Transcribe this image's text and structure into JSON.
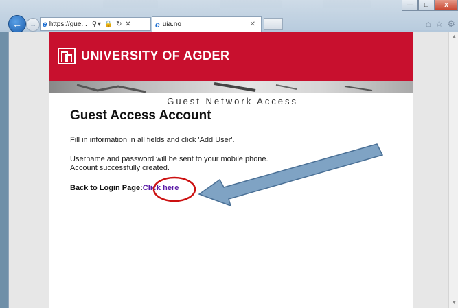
{
  "browser": {
    "address_text": "https://gue...",
    "tab_title": "uia.no",
    "window_buttons": [
      "minimize-icon",
      "restore-icon",
      "close-icon"
    ],
    "toolbar_icons": [
      "home-icon",
      "star-icon",
      "gear-icon"
    ]
  },
  "page": {
    "university_name": "UNIVERSITY OF AGDER",
    "network_title": "Guest Network Access",
    "heading": "Guest Access Account",
    "instruction": "Fill in information in all fields and click 'Add User'.",
    "sent_notice": "Username and password will be sent to your mobile phone.",
    "created_notice": "Account successfully created.",
    "back_label": "Back to Login Page:",
    "back_link": "Click here"
  },
  "colors": {
    "brand_red": "#c8102e",
    "link_purple": "#5a1aa6",
    "annotation_circle": "#cc1111",
    "annotation_arrow": "#7fa3c4"
  }
}
